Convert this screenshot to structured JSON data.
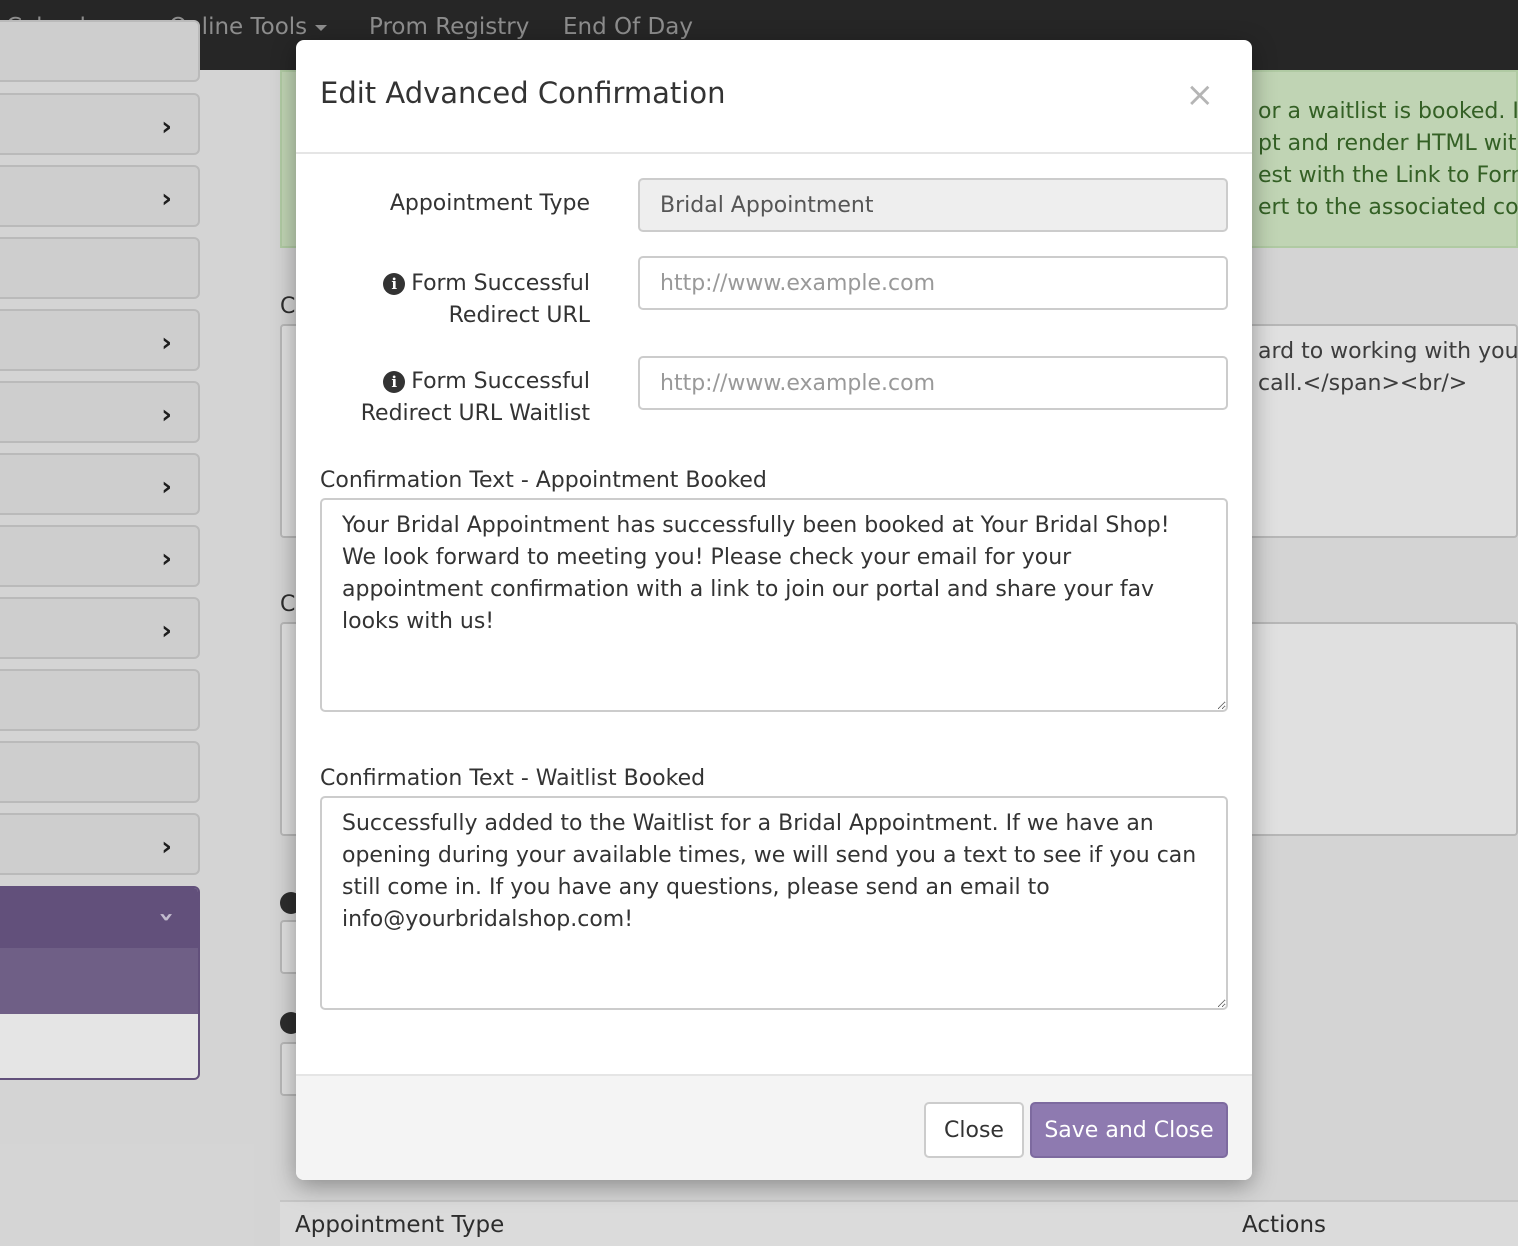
{
  "topnav": {
    "items": [
      "Calendar",
      "Online Tools",
      "Prom Registry",
      "End Of Day"
    ]
  },
  "background": {
    "green_notice_lines": [
      "or a waitlist is booked. If y",
      "pt and render HTML with",
      "est with the Link to Form",
      "ert to the associated conf"
    ],
    "textarea_lines": [
      "ard to working with you!",
      "call.</span><br/>"
    ],
    "label_fragment": "C",
    "table_headers": [
      "Appointment Type",
      "Actions"
    ]
  },
  "modal": {
    "title": "Edit Advanced Confirmation",
    "close_symbol": "×",
    "fields": {
      "appointment_type_label": "Appointment Type",
      "appointment_type_value": "Bridal Appointment",
      "redirect_url_label_line1": "Form Successful",
      "redirect_url_label_line2": "Redirect URL",
      "redirect_url_placeholder": "http://www.example.com",
      "redirect_waitlist_label_line1": "Form Successful",
      "redirect_waitlist_label_line2": "Redirect URL Waitlist",
      "redirect_waitlist_placeholder": "http://www.example.com"
    },
    "appointment_booked": {
      "label": "Confirmation Text - Appointment Booked",
      "text": "Your Bridal Appointment has successfully been booked at Your Bridal Shop! We look forward to meeting you! Please check your email for your appointment confirmation with a link to join our portal and share your fav looks with us!"
    },
    "waitlist_booked": {
      "label": "Confirmation Text - Waitlist Booked",
      "text": "Successfully added to the Waitlist for a Bridal Appointment. If we have an opening during your available times, we will send you a text to see if you can still come in. If you have any questions, please send an email to info@yourbridalshop.com!"
    },
    "footer": {
      "close_label": "Close",
      "save_label": "Save and Close"
    }
  },
  "colors": {
    "accent": "#8e7ab0",
    "sidebar_active": "#6e5a8a",
    "topnav": "#2b2b2b",
    "notice_green": "#d6ecc9"
  }
}
